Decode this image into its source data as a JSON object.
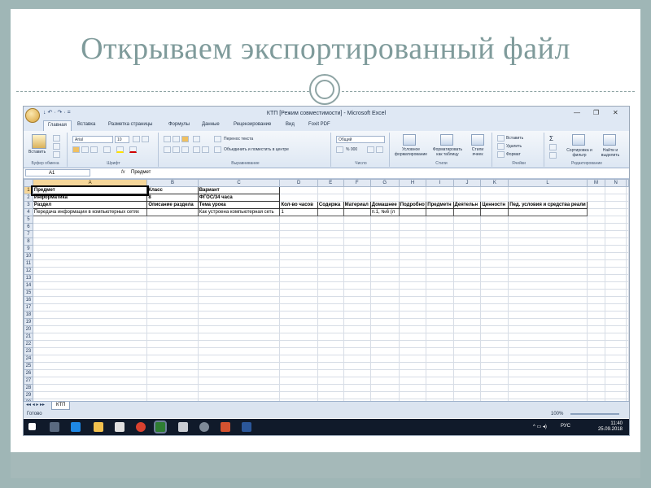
{
  "slide": {
    "title": "Открываем экспортированный файл"
  },
  "excel": {
    "window_title": "КТП  [Режим совместимости] - Microsoft Excel",
    "quick_access": "↓ ↶ · ↷ · =",
    "window_controls": [
      "—",
      "❐",
      "✕"
    ],
    "tabs": [
      "Главная",
      "Вставка",
      "Разметка страницы",
      "Формулы",
      "Данные",
      "Рецензирование",
      "Вид",
      "Foxit PDF"
    ],
    "active_tab": "Главная",
    "ribbon": {
      "paste_label": "Вставить",
      "clipboard_group": "Буфер обмена",
      "font_name": "Arial",
      "font_size": "10",
      "font_group": "Шрифт",
      "wrap_text": "Перенос текста",
      "merge_center": "Объединить и поместить в центре",
      "alignment_group": "Выравнивание",
      "number_format": "Общий",
      "number_symbols": "% 000",
      "number_group": "Число",
      "conditional_format": "Условное форматирование",
      "format_as_table": "Форматировать как таблицу",
      "cell_styles": "Стили ячеек",
      "styles_group": "Стили",
      "insert_cells": "Вставить",
      "delete_cells": "Удалить",
      "format_cells": "Формат",
      "cells_group": "Ячейки",
      "sigma": "Σ",
      "sort_filter": "Сортировка и фильтр",
      "find_select": "Найти и выделить",
      "editing_group": "Редактирование"
    },
    "name_box": "A1",
    "fx_label": "fx",
    "formula_content": "Предмет",
    "columns": [
      "A",
      "B",
      "C",
      "D",
      "E",
      "F",
      "G",
      "H",
      "I",
      "J",
      "K",
      "L",
      "M",
      "N"
    ],
    "rows": [
      [
        "Предмет",
        "Класс",
        "Вариант",
        "",
        "",
        "",
        "",
        "",
        "",
        "",
        "",
        "",
        "",
        ""
      ],
      [
        "Информатика",
        "8",
        "ФГОС/34 часа",
        "",
        "",
        "",
        "",
        "",
        "",
        "",
        "",
        "",
        "",
        ""
      ],
      [
        "Раздел",
        "Описание раздела",
        "Тема урока",
        "Кол-во часов",
        "Содержа",
        "Материал",
        "Домашнее",
        "Подробно",
        "Предметн",
        "Деятельн",
        "Ценностн",
        "Пед. условия и средства реали",
        "",
        ""
      ],
      [
        "Передача информации в компьютерных сетях",
        "",
        "Как устроена компьютерная сеть",
        "1",
        "",
        "",
        "п.1, №6 (л",
        "",
        "",
        "",
        "",
        "",
        "",
        ""
      ]
    ],
    "row_count": 30,
    "sheet_tab": "КТП",
    "status_ready": "Готово",
    "zoom": "100%",
    "taskbar": {
      "language": "РУС",
      "time": "11:40",
      "date": "25.09.2018"
    }
  }
}
